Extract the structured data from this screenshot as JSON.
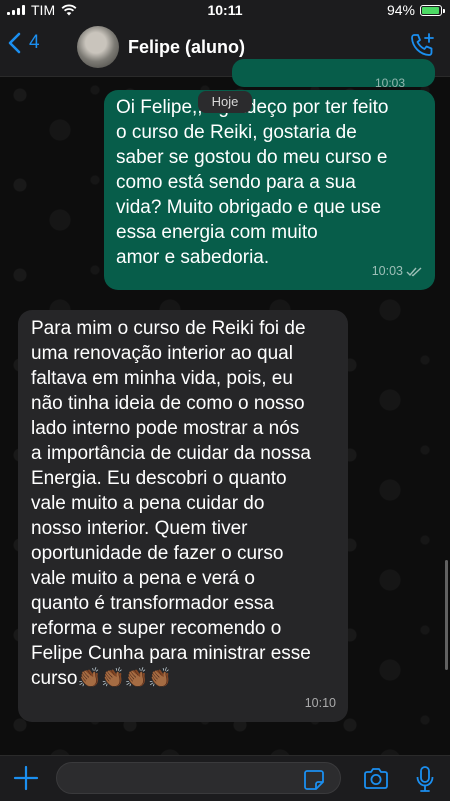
{
  "status_bar": {
    "carrier": "TIM",
    "time": "10:11",
    "battery_percent": "94%",
    "battery_level": 0.94,
    "battery_color": "#4cd964"
  },
  "header": {
    "back_count": "4",
    "contact_name": "Felipe (aluno)",
    "accent_color": "#1b8ff0"
  },
  "chat": {
    "previous_time": "10:03",
    "date_label": "Hoje",
    "messages": [
      {
        "direction": "sent",
        "text": "Oi Felipe,, agradeço por ter feito\no curso de Reiki, gostaria de\nsaber se gostou do meu curso e\ncomo está sendo para a sua\nvida? Muito obrigado e que use\nessa energia com muito\namor e sabedoria.",
        "time": "10:03",
        "status_icon": "double-check-icon",
        "bubble_color": "#075d4a"
      },
      {
        "direction": "received",
        "text": "Para mim o curso de Reiki foi de\numa renovação interior ao qual\nfaltava  em minha vida, pois, eu\nnão tinha ideia de como o nosso\nlado interno pode mostrar a nós\na importância de cuidar da nossa\nEnergia. Eu descobri o quanto\nvale muito a pena cuidar do\nnosso interior. Quem tiver\noportunidade de fazer o curso\nvale muito a pena e verá o\nquanto é transformador essa\nreforma e super recomendo o\nFelipe Cunha para ministrar esse\ncurso👏🏾👏🏾👏🏾👏🏾",
        "time": "10:10",
        "bubble_color": "#262628"
      }
    ]
  },
  "composer": {
    "input_value": "",
    "icons": [
      "plus-icon",
      "sticker-icon",
      "camera-icon",
      "microphone-icon"
    ]
  }
}
